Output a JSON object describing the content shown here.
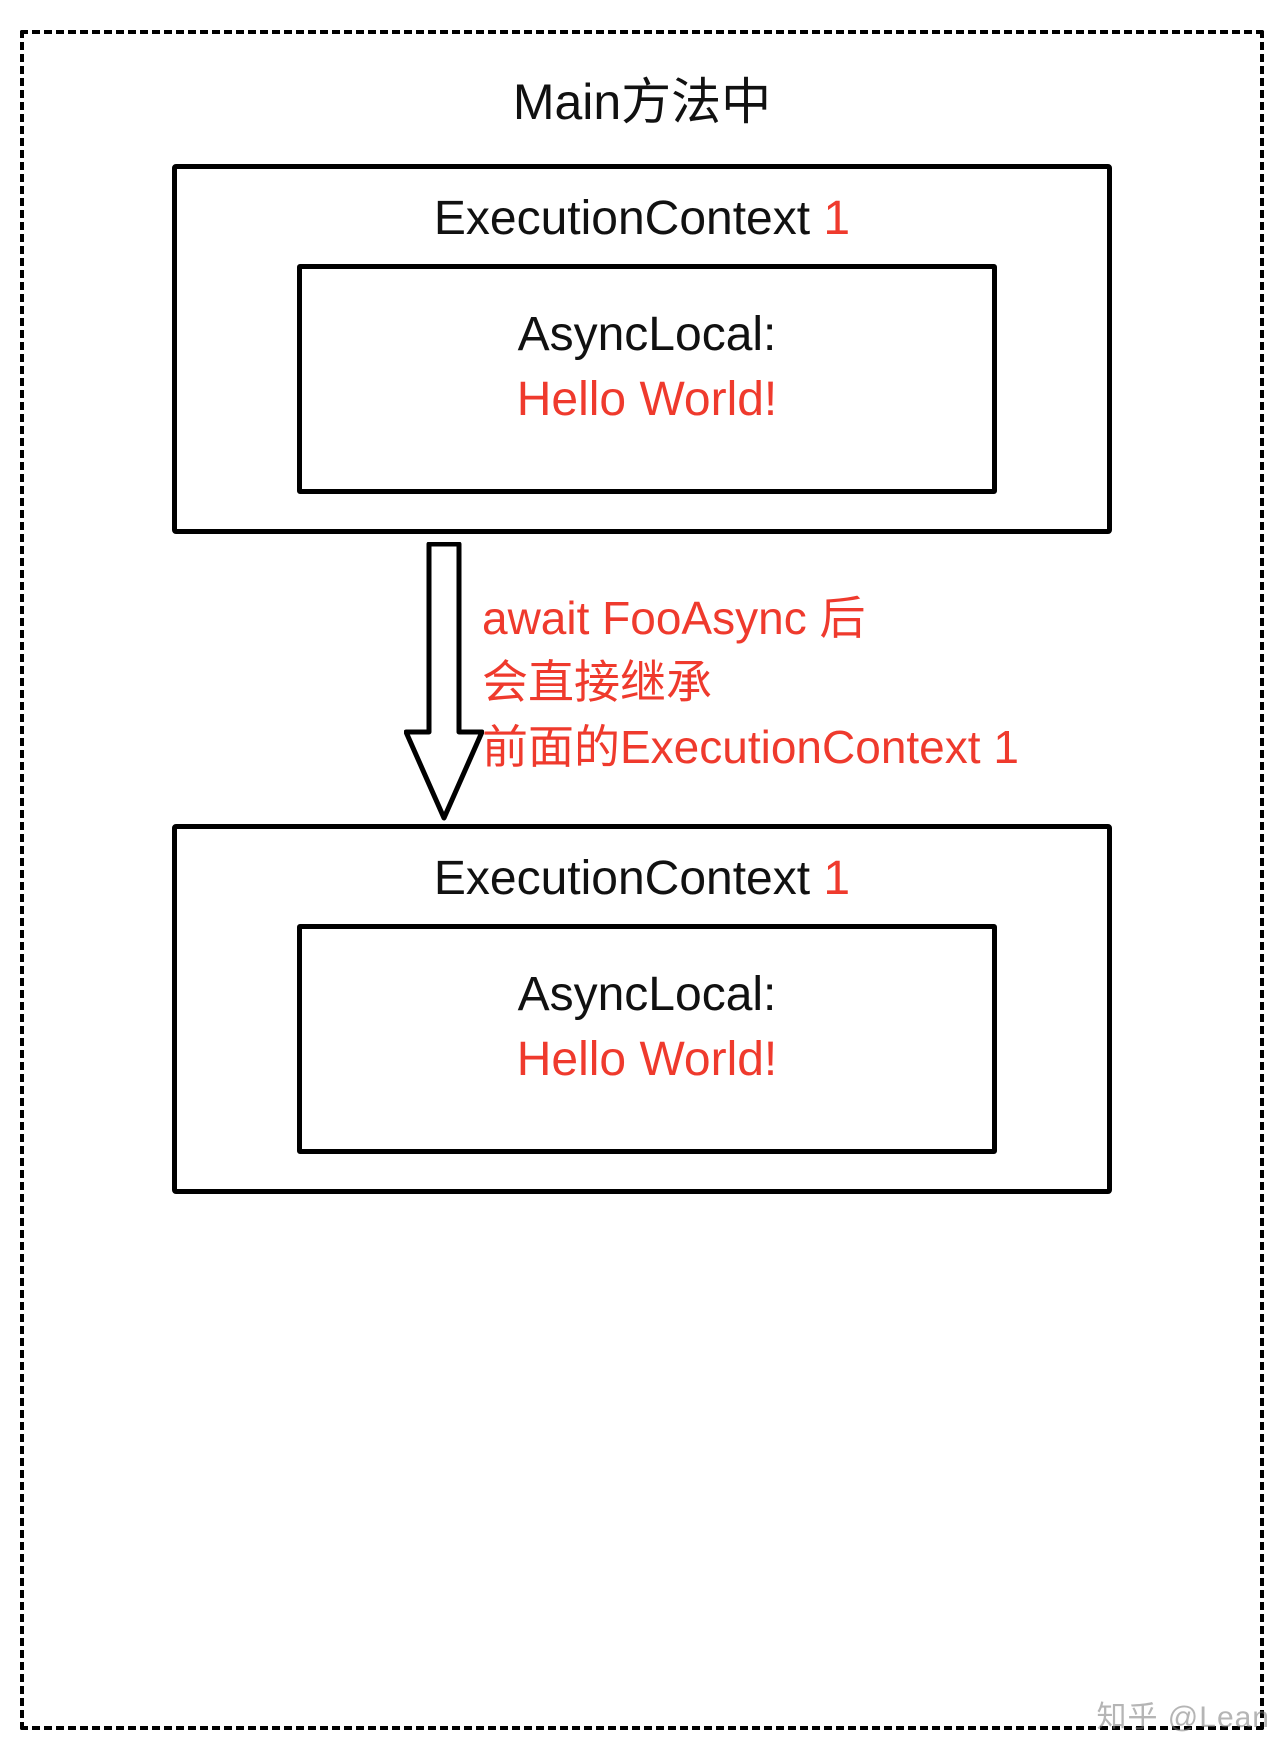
{
  "outer_title": "Main方法中",
  "context1": {
    "title_prefix": "ExecutionContext ",
    "title_num": "1",
    "inner_label": "AsyncLocal:",
    "inner_value": "Hello World!"
  },
  "arrow_annotation": {
    "line1": "await FooAsync 后",
    "line2": "会直接继承",
    "line3": "前面的ExecutionContext 1"
  },
  "context2": {
    "title_prefix": "ExecutionContext ",
    "title_num": "1",
    "inner_label": "AsyncLocal:",
    "inner_value": "Hello World!"
  },
  "watermark": "知乎 @Lean"
}
